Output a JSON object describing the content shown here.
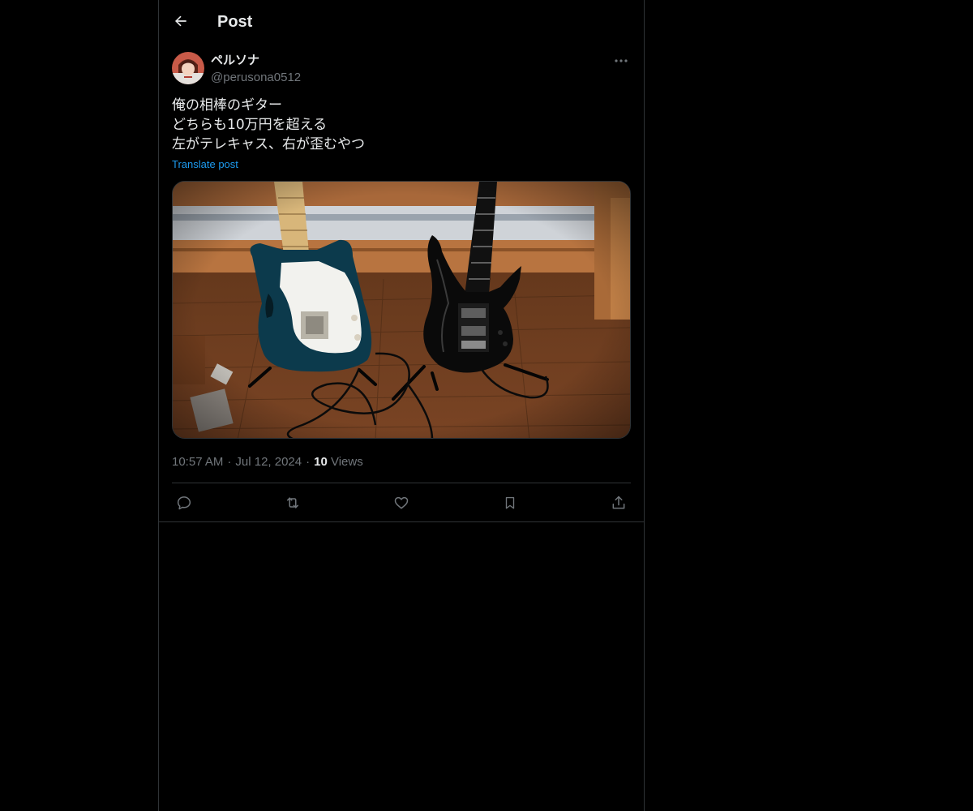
{
  "header": {
    "back_icon": "arrow-left-icon",
    "title": "Post"
  },
  "author": {
    "display_name": "ペルソナ",
    "handle": "@perusona0512",
    "avatar_icon": "avatar-image",
    "more_icon": "more-horizontal-icon"
  },
  "post": {
    "lines": [
      "俺の相棒のギター",
      "どちらも10万円を超える",
      "左がテレキャス、右が歪むやつ"
    ],
    "translate_label": "Translate post",
    "media_icon": "photo-two-guitars"
  },
  "meta": {
    "time": "10:57 AM",
    "separator": "·",
    "date": "Jul 12, 2024",
    "views_count": "10",
    "views_label": "Views"
  },
  "actions": {
    "reply_icon": "reply-icon",
    "repost_icon": "repost-icon",
    "like_icon": "heart-icon",
    "bookmark_icon": "bookmark-icon",
    "share_icon": "share-icon"
  },
  "colors": {
    "background": "#000000",
    "text": "#e7e9ea",
    "secondary": "#71767b",
    "link": "#1d9bf0",
    "border": "#2f3336"
  }
}
